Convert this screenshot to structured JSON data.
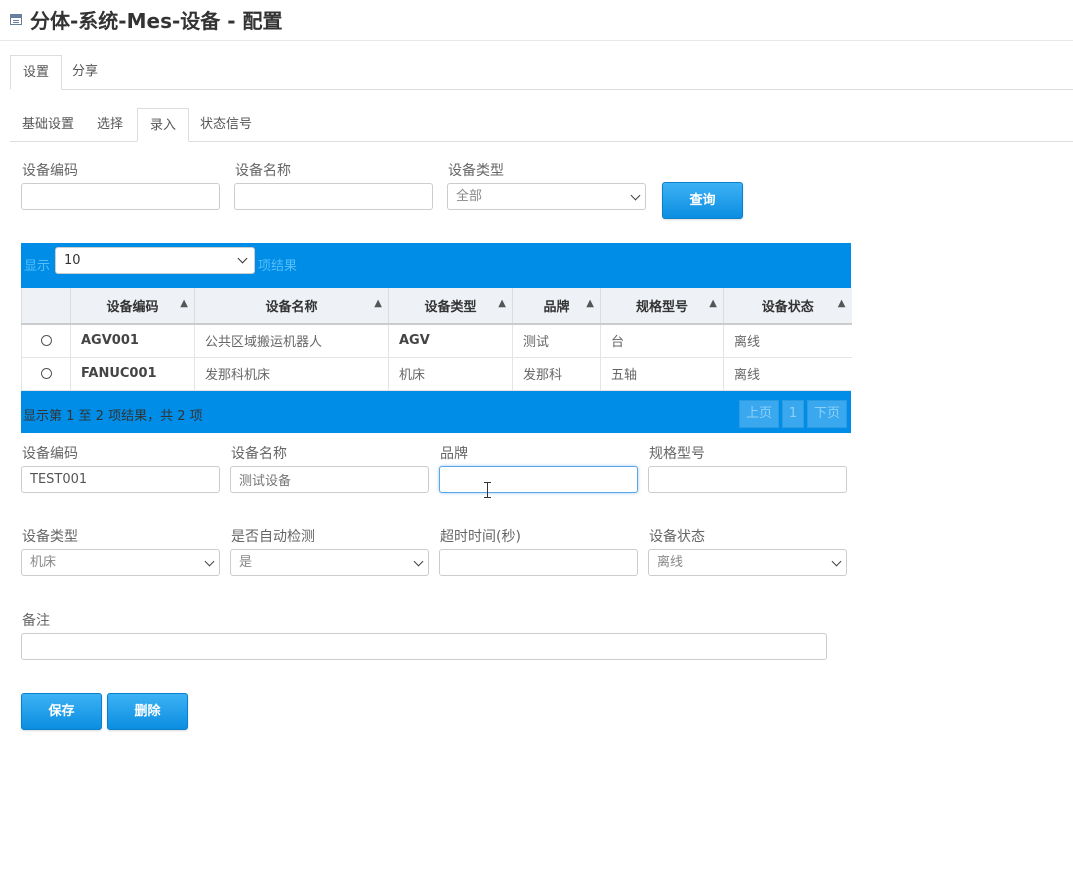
{
  "header": {
    "title": "分体-系统-Mes-设备 - 配置",
    "icon": "window-icon"
  },
  "tabs_main": [
    {
      "label": "设置",
      "active": true
    },
    {
      "label": "分享",
      "active": false
    }
  ],
  "tabs_sub": [
    {
      "label": "基础设置",
      "active": false
    },
    {
      "label": "选择",
      "active": false
    },
    {
      "label": "录入",
      "active": true
    },
    {
      "label": "状态信号",
      "active": false
    }
  ],
  "filter": {
    "code_label": "设备编码",
    "code_value": "",
    "name_label": "设备名称",
    "name_value": "",
    "type_label": "设备类型",
    "type_value": "全部",
    "query_button": "查询"
  },
  "table": {
    "show_prefix": "显示",
    "page_length": "10",
    "show_suffix": "项结果",
    "columns": [
      "设备编码",
      "设备名称",
      "设备类型",
      "品牌",
      "规格型号",
      "设备状态"
    ],
    "rows": [
      {
        "code": "AGV001",
        "name": "公共区域搬运机器人",
        "type": "AGV",
        "brand": "测试",
        "spec": "台",
        "status": "离线"
      },
      {
        "code": "FANUC001",
        "name": "发那科机床",
        "type": "机床",
        "brand": "发那科",
        "spec": "五轴",
        "status": "离线"
      }
    ],
    "info": "显示第 1 至 2 项结果，共 2 项",
    "pager": {
      "prev": "上页",
      "page": "1",
      "next": "下页"
    }
  },
  "form": {
    "code_label": "设备编码",
    "code_value": "TEST001",
    "name_label": "设备名称",
    "name_value": "测试设备",
    "brand_label": "品牌",
    "brand_value": "",
    "spec_label": "规格型号",
    "spec_value": "",
    "type_label": "设备类型",
    "type_value": "机床",
    "auto_label": "是否自动检测",
    "auto_value": "是",
    "timeout_label": "超时时间(秒)",
    "timeout_value": "",
    "status_label": "设备状态",
    "status_value": "离线",
    "remark_label": "备注",
    "remark_value": "",
    "save_button": "保存",
    "delete_button": "删除"
  },
  "colors": {
    "accent": "#008de8",
    "button": "#1a9be8",
    "header_bg": "#eef2f7"
  }
}
